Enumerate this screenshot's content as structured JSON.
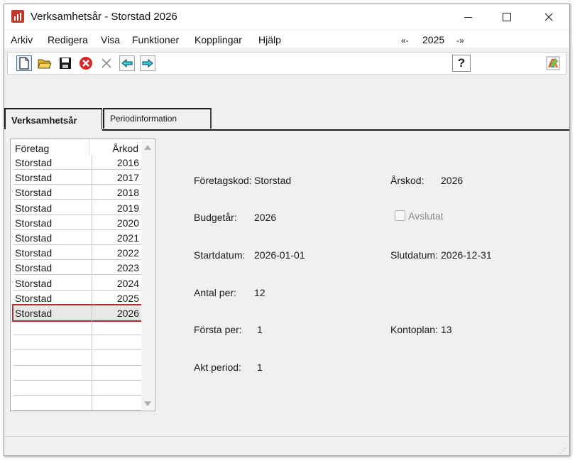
{
  "window": {
    "title": "Verksamhetsår - Storstad 2026"
  },
  "menu": {
    "items": [
      "Arkiv",
      "Redigera",
      "Visa",
      "Funktioner",
      "Kopplingar",
      "Hjälp"
    ],
    "year_prev": "«-",
    "year": "2025",
    "year_next": "-»"
  },
  "toolbar": {
    "icons": [
      "new-document-icon",
      "open-folder-icon",
      "save-icon",
      "cancel-icon",
      "delete-icon",
      "back-arrow-icon",
      "forward-arrow-icon",
      "help-icon",
      "palette-icon"
    ],
    "help_label": "?"
  },
  "tabs": [
    {
      "label": "Verksamhetsår",
      "active": true
    },
    {
      "label": "Periodinformation",
      "active": false
    }
  ],
  "list": {
    "columns": [
      "Företag",
      "Årkod"
    ],
    "rows": [
      {
        "company": "Storstad",
        "year": "2016"
      },
      {
        "company": "Storstad",
        "year": "2017"
      },
      {
        "company": "Storstad",
        "year": "2018"
      },
      {
        "company": "Storstad",
        "year": "2019"
      },
      {
        "company": "Storstad",
        "year": "2020"
      },
      {
        "company": "Storstad",
        "year": "2021"
      },
      {
        "company": "Storstad",
        "year": "2022"
      },
      {
        "company": "Storstad",
        "year": "2023"
      },
      {
        "company": "Storstad",
        "year": "2024"
      },
      {
        "company": "Storstad",
        "year": "2025"
      },
      {
        "company": "Storstad",
        "year": "2026",
        "selected": true
      }
    ],
    "empty_rows": 6
  },
  "details": {
    "foretagskod_label": "Företagskod:",
    "foretagskod": "Storstad",
    "arskod_label": "Årskod:",
    "arskod": "2026",
    "budgetar_label": "Budgetår:",
    "budgetar": "2026",
    "avslutat_label": "Avslutat",
    "startdatum_label": "Startdatum:",
    "startdatum": "2026-01-01",
    "slutdatum_label": "Slutdatum:",
    "slutdatum": "2026-12-31",
    "antal_per_label": "Antal per:",
    "antal_per": "12",
    "forsta_per_label": "Första per:",
    "forsta_per": "1",
    "kontoplan_label": "Kontoplan:",
    "kontoplan": "13",
    "akt_period_label": "Akt period:",
    "akt_period": "1"
  },
  "colors": {
    "selection_border": "#b5303c",
    "app_icon": "#c0392b"
  }
}
